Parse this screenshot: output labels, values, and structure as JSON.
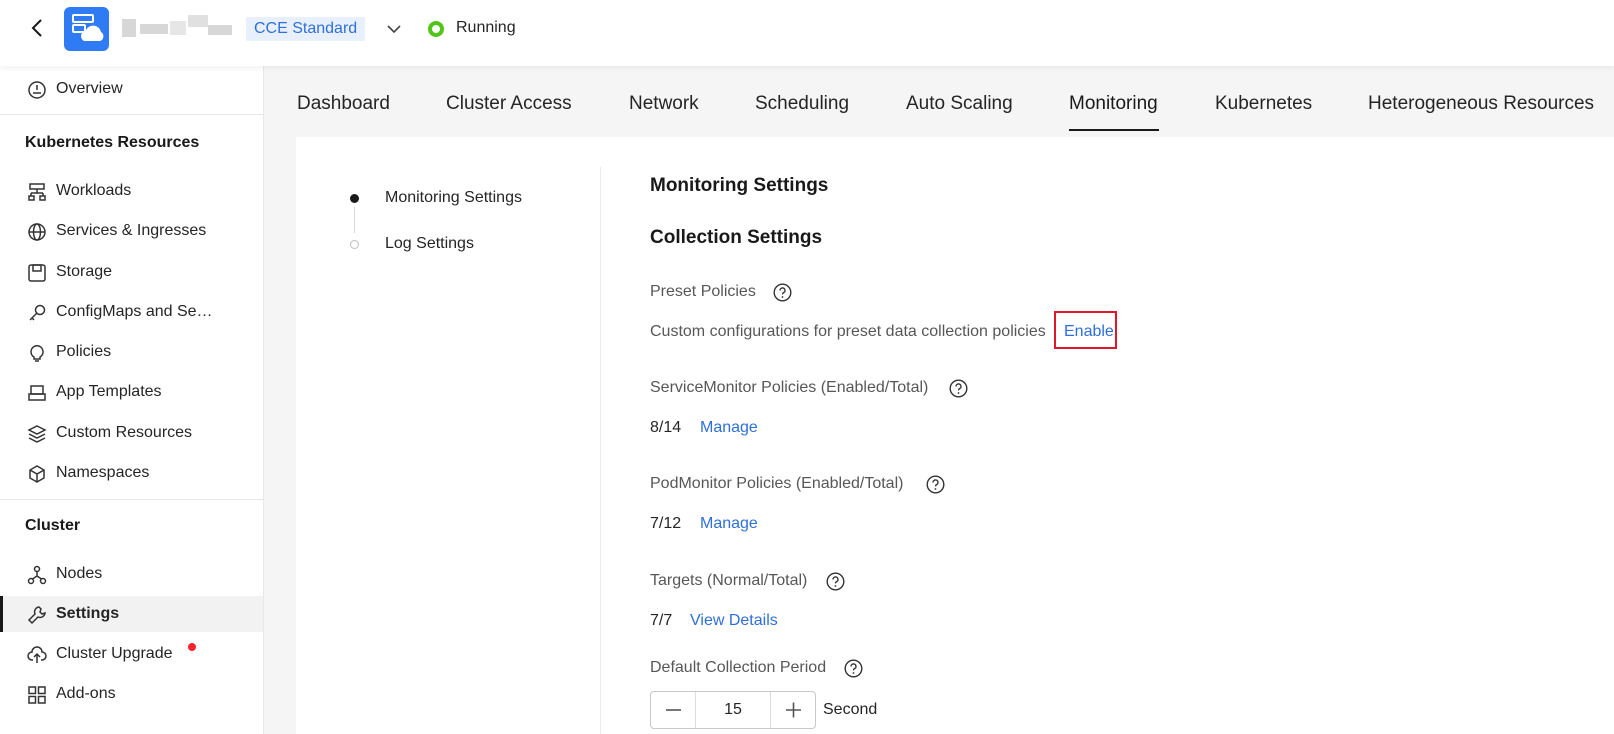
{
  "header": {
    "cluster_type": "CCE Standard",
    "status": "Running",
    "colors": {
      "accent": "#2f6fd8",
      "status_ok": "#52c41a",
      "brand_icon": "#2f7bf4"
    }
  },
  "sidebar": {
    "overview": "Overview",
    "section_k8s": "Kubernetes Resources",
    "k8s_items": [
      {
        "label": "Workloads",
        "icon": "workloads-icon"
      },
      {
        "label": "Services & Ingresses",
        "icon": "globe-icon"
      },
      {
        "label": "Storage",
        "icon": "storage-icon"
      },
      {
        "label": "ConfigMaps and Se…",
        "icon": "key-icon"
      },
      {
        "label": "Policies",
        "icon": "lightbulb-icon"
      },
      {
        "label": "App Templates",
        "icon": "template-icon"
      },
      {
        "label": "Custom Resources",
        "icon": "layers-icon"
      },
      {
        "label": "Namespaces",
        "icon": "cube-icon"
      }
    ],
    "section_cluster": "Cluster",
    "cluster_items": [
      {
        "label": "Nodes",
        "icon": "nodes-icon"
      },
      {
        "label": "Settings",
        "icon": "wrench-icon",
        "active": true
      },
      {
        "label": "Cluster Upgrade",
        "icon": "cloud-upload-icon",
        "badge": "red-dot"
      },
      {
        "label": "Add-ons",
        "icon": "grid-icon"
      }
    ]
  },
  "tabs": [
    {
      "label": "Dashboard"
    },
    {
      "label": "Cluster Access"
    },
    {
      "label": "Network"
    },
    {
      "label": "Scheduling"
    },
    {
      "label": "Auto Scaling"
    },
    {
      "label": "Monitoring",
      "active": true
    },
    {
      "label": "Kubernetes"
    },
    {
      "label": "Heterogeneous Resources"
    }
  ],
  "steps": [
    {
      "label": "Monitoring Settings",
      "active": true
    },
    {
      "label": "Log Settings",
      "active": false
    }
  ],
  "main": {
    "title": "Monitoring Settings",
    "subtitle": "Collection Settings",
    "preset_label": "Preset Policies",
    "preset_desc": "Custom configurations for preset data collection policies",
    "preset_link": "Enable",
    "servicemonitor_label": "ServiceMonitor Policies (Enabled/Total)",
    "servicemonitor_value": "8/14",
    "servicemonitor_link": "Manage",
    "podmonitor_label": "PodMonitor Policies (Enabled/Total)",
    "podmonitor_value": "7/12",
    "podmonitor_link": "Manage",
    "targets_label": "Targets (Normal/Total)",
    "targets_value": "7/7",
    "targets_link": "View Details",
    "period_label": "Default Collection Period",
    "period_value": "15",
    "period_unit": "Second"
  }
}
